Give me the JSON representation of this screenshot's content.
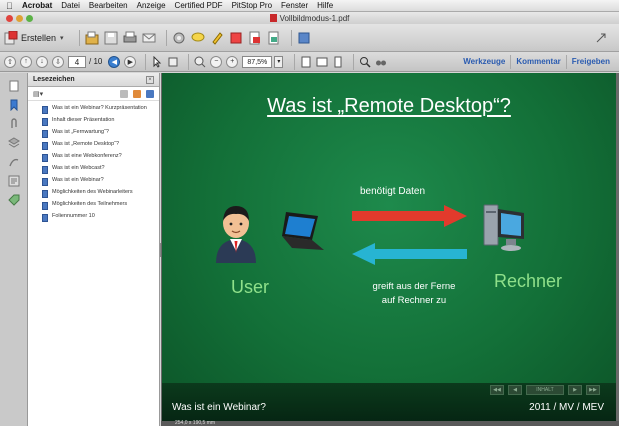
{
  "menubar": {
    "items": [
      "Acrobat",
      "Datei",
      "Bearbeiten",
      "Anzeige",
      "Certified PDF",
      "PitStop Pro",
      "Fenster",
      "Hilfe"
    ]
  },
  "window": {
    "title": "Vollbildmodus-1.pdf"
  },
  "toolbar1": {
    "create_label": "Erstellen",
    "icons": [
      "create-icon",
      "open-icon",
      "save-icon",
      "print-icon",
      "email-icon",
      "settings-icon",
      "comment-icon",
      "highlight-icon",
      "stamp-icon",
      "attach-icon",
      "export-icon",
      "share-icon"
    ]
  },
  "toolbar2": {
    "page_current": "4",
    "page_total": "/ 10",
    "zoom": "87,5%",
    "tabs": [
      "Werkzeuge",
      "Kommentar",
      "Freigeben"
    ]
  },
  "bookmarks": {
    "title": "Lesezeichen",
    "items": [
      "Was ist ein Webinar? Kurzpräsentation",
      "Inhalt dieser Präsentation",
      "Was ist „Fernwartung“?",
      "Was ist „Remote Desktop“?",
      "Was ist eine Webkonferenz?",
      "Was ist ein Webcast?",
      "Was ist ein Webinar?",
      "Möglichkeiten des Webinarleiters",
      "Möglichkeiten des Teilnehmers",
      "Foliennummer 10"
    ]
  },
  "slide": {
    "title": "Was ist „Remote Desktop“?",
    "arrow_top_label": "benötigt Daten",
    "arrow_bottom_label_1": "greift aus der Ferne",
    "arrow_bottom_label_2": "auf Rechner zu",
    "user_label": "User",
    "computer_label": "Rechner",
    "footer_left": "Was ist ein Webinar?",
    "footer_right": "2011 / MV / MEV",
    "nav_middle": "INHALT"
  },
  "page_size": "254,0 x 190,5 mm",
  "colors": {
    "slide_green": "#137038",
    "accent_label": "#8fe08a",
    "arrow_red": "#e23a2c",
    "arrow_cyan": "#27b4d2",
    "link_blue": "#2a5bb0"
  }
}
